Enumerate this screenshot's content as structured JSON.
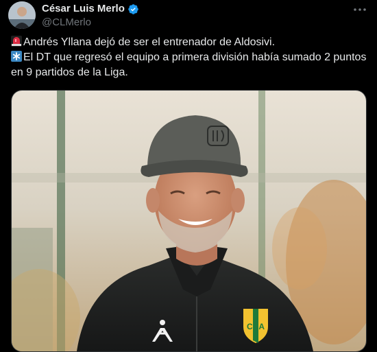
{
  "author": {
    "display_name": "César Luis Merlo",
    "handle": "@CLMerlo",
    "verified": true
  },
  "tweet": {
    "line1": "Andrés Yllana dejó de ser el entrenador de Aldosivi.",
    "line2": "El DT que regresó el equipo a primera división había sumado 2 puntos",
    "line3": "en 9 partidos de la Liga."
  },
  "icons": {
    "more": "more-horizontal-icon",
    "verified": "verified-badge-icon",
    "emoji1": "police-light-emoji",
    "emoji2": "asterisk-emoji"
  },
  "media": {
    "jersey_badge_text": "CAA"
  },
  "colors": {
    "background": "#000000",
    "text_primary": "#e7e9ea",
    "text_secondary": "#71767b",
    "verified_blue": "#1d9bf0"
  }
}
